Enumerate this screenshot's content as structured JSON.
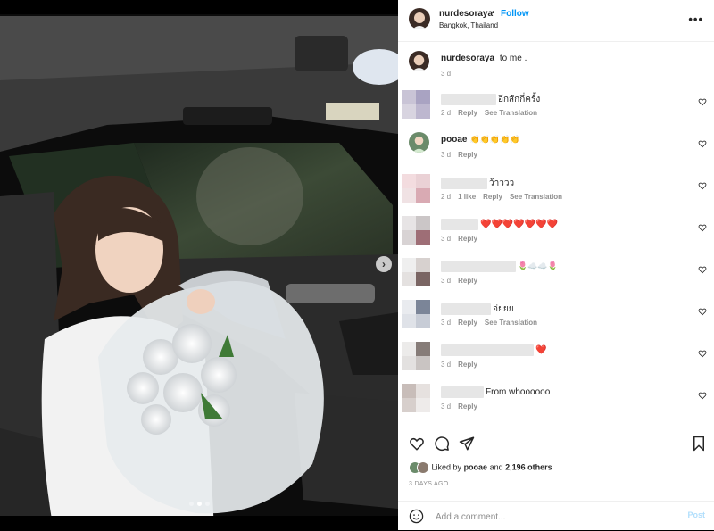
{
  "post": {
    "username": "nurdesoraya",
    "follow_label": "Follow",
    "separator": "•",
    "location": "Bangkok, Thailand",
    "more_label": "•••",
    "photo_alt": "Woman holding a white rose bouquet in a car",
    "carousel_next": "›",
    "carousel_dots": 3,
    "carousel_active": 2
  },
  "caption": {
    "username": "nurdesoraya",
    "text": "to me .",
    "time": "3 d"
  },
  "comments": [
    {
      "text": "อีกสักกี่ครั้ง",
      "time": "2 d",
      "likes": "",
      "reply": "Reply",
      "translate": "See Translation"
    },
    {
      "username": "pooae",
      "text": "👏👏👏👏👏",
      "time": "3 d",
      "likes": "",
      "reply": "Reply",
      "translate": ""
    },
    {
      "text": "ว้าววว",
      "time": "2 d",
      "likes": "1 like",
      "reply": "Reply",
      "translate": "See Translation"
    },
    {
      "text": "❤️❤️❤️❤️❤️❤️❤️",
      "time": "3 d",
      "likes": "",
      "reply": "Reply",
      "translate": ""
    },
    {
      "text": "🌷☁️☁️🌷",
      "time": "3 d",
      "likes": "",
      "reply": "Reply",
      "translate": ""
    },
    {
      "text": "อ่ยยย",
      "time": "3 d",
      "likes": "",
      "reply": "Reply",
      "translate": "See Translation"
    },
    {
      "text": "❤️",
      "time": "3 d",
      "likes": "",
      "reply": "Reply",
      "translate": ""
    },
    {
      "text": "From whoooooo",
      "time": "3 d",
      "likes": "",
      "reply": "Reply",
      "translate": ""
    }
  ],
  "actions": {
    "liked_prefix": "Liked by",
    "liked_user": "pooae",
    "liked_and": "and",
    "liked_others": "2,196 others",
    "posted_ago": "3 DAYS AGO"
  },
  "add_comment": {
    "placeholder": "Add a comment...",
    "post_label": "Post"
  },
  "colors": {
    "accent": "#0095f6",
    "post_disabled": "#b2dffc",
    "heart": "#e0245e",
    "muted": "#8e8e8e"
  },
  "icons": [
    "chevron-right-icon",
    "more-icon",
    "heart-icon",
    "comment-icon",
    "share-icon",
    "bookmark-icon",
    "smile-icon"
  ]
}
